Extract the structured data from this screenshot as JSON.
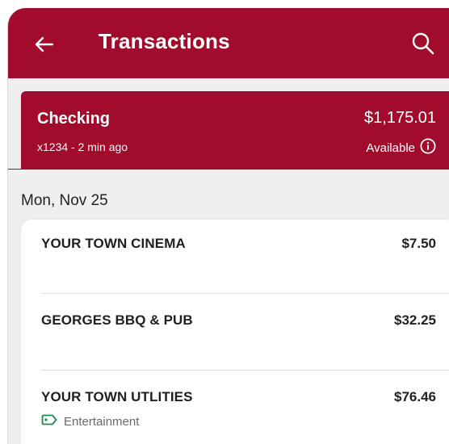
{
  "header": {
    "title": "Transactions",
    "back_icon": "arrow-left-icon",
    "search_icon": "search-icon"
  },
  "account": {
    "name": "Checking",
    "meta": "x1234 - 2 min ago",
    "balance": "$1,175.01",
    "available_label": "Available",
    "info_icon": "info-icon"
  },
  "date_group": "Mon, Nov 25",
  "transactions": [
    {
      "merchant": "YOUR TOWN CINEMA",
      "amount": "$7.50"
    },
    {
      "merchant": "GEORGES BBQ & PUB",
      "amount": "$32.25"
    },
    {
      "merchant": "YOUR TOWN UTLITIES",
      "amount": "$76.46",
      "category": "Entertainment",
      "category_icon": "tag-icon"
    }
  ],
  "colors": {
    "brand": "#a10c2c",
    "background": "#efefef",
    "category_icon": "#1e8b4f"
  }
}
